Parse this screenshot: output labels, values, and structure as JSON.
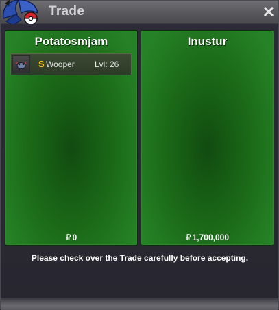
{
  "window": {
    "title": "Trade",
    "close_icon": "close-icon",
    "logo_icon": "pokeball-logo-icon"
  },
  "left_panel": {
    "player_name": "Potatosmjam",
    "items": [
      {
        "name": "Wooper",
        "level_text": "Lvl: 26",
        "shiny_badge": "S",
        "icon": "pokemon-sprite-icon"
      }
    ],
    "money_symbol": "₽",
    "money": "0"
  },
  "right_panel": {
    "player_name": "Inustur",
    "money_symbol": "₽",
    "money": "1,700,000"
  },
  "footer_note": "Please check over the Trade carefully before accepting.",
  "colors": {
    "panel_green": "#1b6a18",
    "panel_dark_center": "#114b10",
    "titlebar": "#5f5f64",
    "shiny_gold": "#f3c21a"
  }
}
